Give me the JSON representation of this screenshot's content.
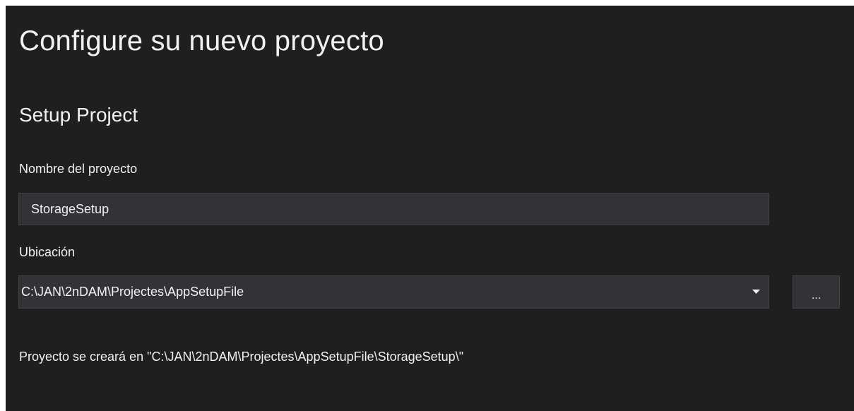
{
  "header": {
    "title": "Configure su nuevo proyecto",
    "template_name": "Setup Project"
  },
  "form": {
    "project_name": {
      "label": "Nombre del proyecto",
      "value": "StorageSetup"
    },
    "location": {
      "label": "Ubicación",
      "value": "C:\\JAN\\2nDAM\\Projectes\\AppSetupFile",
      "dropdown_icon": "caret-down-icon",
      "browse_label": "..."
    },
    "output_path_message": "Proyecto se creará en \"C:\\JAN\\2nDAM\\Projectes\\AppSetupFile\\StorageSetup\\\""
  },
  "colors": {
    "background": "#1f1f1f",
    "input_background": "#333337",
    "input_border": "#3f3f46",
    "text": "#f1f1f1"
  }
}
